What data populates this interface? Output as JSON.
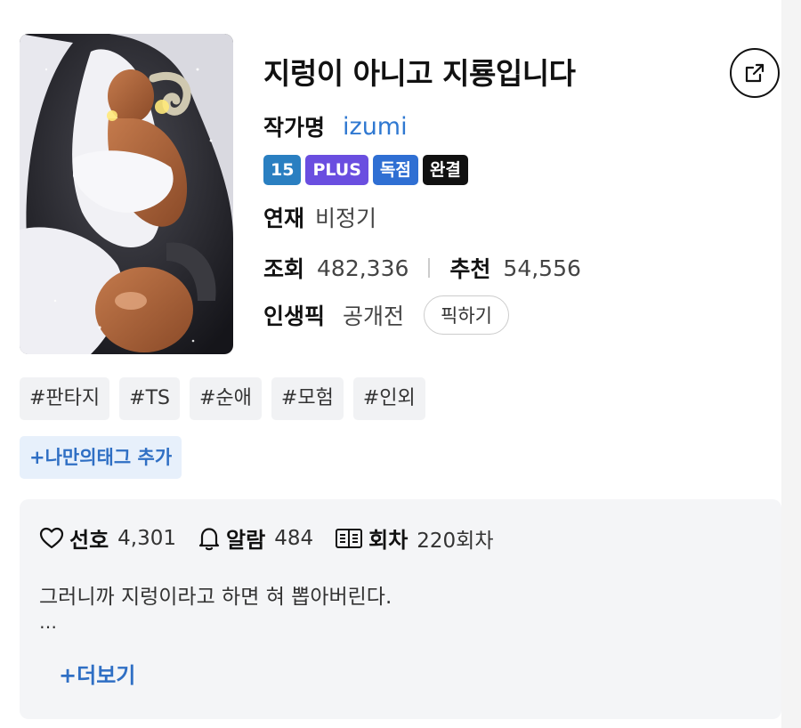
{
  "title": "지렁이 아니고 지룡입니다",
  "author": {
    "label": "작가명",
    "name": "izumi"
  },
  "badges": {
    "age": "15",
    "plus": "PLUS",
    "exclusive": "독점",
    "status": "완결"
  },
  "serial": {
    "label": "연재",
    "value": "비정기"
  },
  "stats": {
    "views_label": "조회",
    "views": "482,336",
    "recommend_label": "추천",
    "recommend": "54,556"
  },
  "pick": {
    "label": "인생픽",
    "value": "공개전",
    "button": "픽하기"
  },
  "tags": [
    "#판타지",
    "#TS",
    "#순애",
    "#모험",
    "#인외"
  ],
  "add_tag": "+나만의태그 추가",
  "info": {
    "favorite_label": "선호",
    "favorite": "4,301",
    "alarm_label": "알람",
    "alarm": "484",
    "episodes_label": "회차",
    "episodes": "220회차"
  },
  "synopsis": "그러니까 지렁이라고 하면 혀 뽑아버린다.",
  "synopsis_ellipsis": "…",
  "more": "+더보기",
  "colors": {
    "accent": "#2f78d1",
    "plus": "#6a4ee0",
    "age": "#2a7fc1",
    "exclusive": "#2f6fd3",
    "done": "#111111"
  },
  "icons": {
    "share": "share-icon",
    "favorite": "heart-icon",
    "alarm": "bell-icon",
    "episodes": "book-icon"
  }
}
